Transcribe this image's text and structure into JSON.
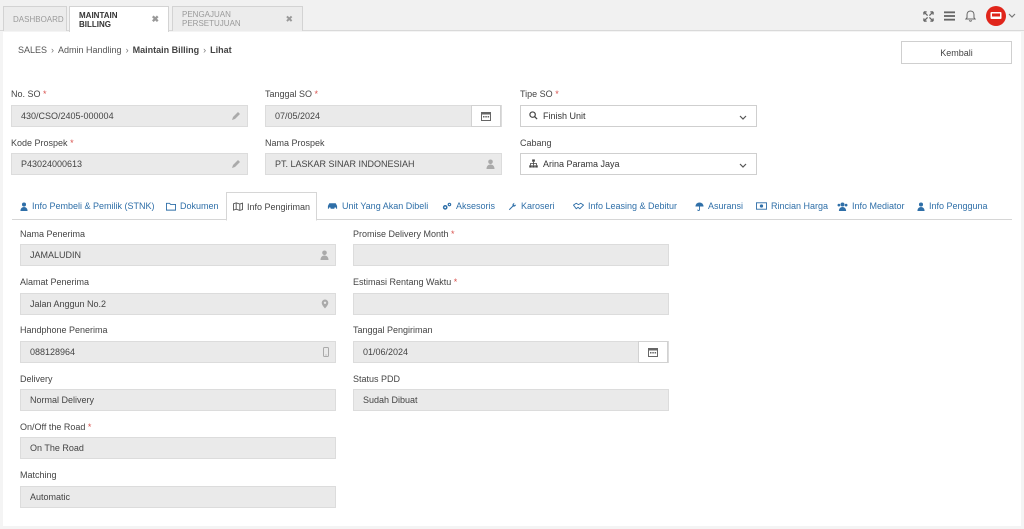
{
  "topbar": {
    "tabs": [
      {
        "label": "DASHBOARD"
      },
      {
        "label": "MAINTAIN BILLING",
        "close": "✖"
      },
      {
        "label": "PENGAJUAN PERSETUJUAN",
        "close": "✖"
      }
    ]
  },
  "breadcrumb": {
    "items": [
      "SALES",
      "Admin Handling",
      "Maintain Billing",
      "Lihat"
    ],
    "separator": "›"
  },
  "actions": {
    "back_label": "Kembali"
  },
  "header_form": {
    "no_so": {
      "label": "No. SO",
      "value": "430/CSO/2405-000004"
    },
    "tanggal_so": {
      "label": "Tanggal SO",
      "value": "07/05/2024"
    },
    "tipe_so": {
      "label": "Tipe SO",
      "value": "Finish Unit"
    },
    "kode_prospek": {
      "label": "Kode Prospek",
      "value": "P43024000613"
    },
    "nama_prospek": {
      "label": "Nama Prospek",
      "value": "PT. LASKAR SINAR INDONESIAH"
    },
    "cabang": {
      "label": "Cabang",
      "value": "Arina Parama Jaya"
    },
    "required_mark": "*"
  },
  "section_tabs": [
    {
      "label": "Info Pembeli & Pemilik (STNK)",
      "icon": "user-icon"
    },
    {
      "label": "Dokumen",
      "icon": "folder-icon"
    },
    {
      "label": "Info Pengiriman",
      "icon": "map-icon",
      "active": true
    },
    {
      "label": "Unit Yang Akan Dibeli",
      "icon": "car-icon"
    },
    {
      "label": "Aksesoris",
      "icon": "cogs-icon"
    },
    {
      "label": "Karoseri",
      "icon": "wrench-icon"
    },
    {
      "label": "Info Leasing & Debitur",
      "icon": "handshake-icon"
    },
    {
      "label": "Asuransi",
      "icon": "umbrella-icon"
    },
    {
      "label": "Rincian Harga",
      "icon": "money-icon"
    },
    {
      "label": "Info Mediator",
      "icon": "users-icon"
    },
    {
      "label": "Info Pengguna",
      "icon": "user-icon"
    }
  ],
  "pengiriman": {
    "nama_penerima": {
      "label": "Nama Penerima",
      "value": "JAMALUDIN"
    },
    "alamat_penerima": {
      "label": "Alamat Penerima",
      "value": "Jalan Anggun No.2"
    },
    "handphone_penerima": {
      "label": "Handphone Penerima",
      "value": "088128964"
    },
    "delivery": {
      "label": "Delivery",
      "value": "Normal Delivery"
    },
    "on_off_road": {
      "label": "On/Off the Road",
      "value": "On The Road"
    },
    "matching": {
      "label": "Matching",
      "value": "Automatic"
    },
    "promise_delivery_month": {
      "label": "Promise Delivery Month",
      "value": ""
    },
    "estimasi_rentang_waktu": {
      "label": "Estimasi Rentang Waktu",
      "value": ""
    },
    "tanggal_pengiriman": {
      "label": "Tanggal Pengiriman",
      "value": "01/06/2024"
    },
    "status_pdd": {
      "label": "Status PDD",
      "value": "Sudah Dibuat"
    }
  },
  "colors": {
    "link": "#2f6fa8",
    "required": "#d9534f",
    "avatar": "#e0251b"
  }
}
